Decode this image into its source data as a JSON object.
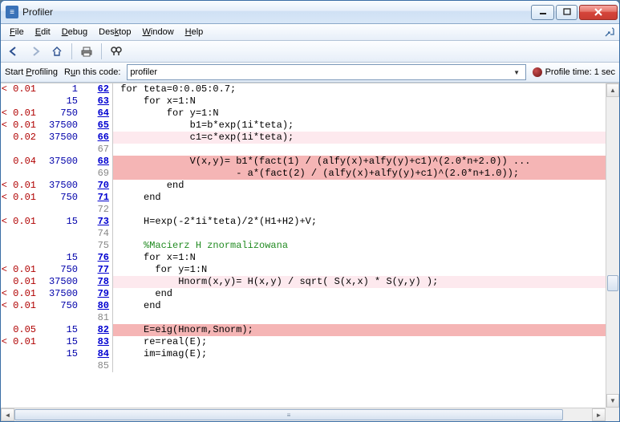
{
  "window": {
    "title": "Profiler",
    "icon_glyph": "≡"
  },
  "menu": [
    "File",
    "Edit",
    "Debug",
    "Desktop",
    "Window",
    "Help"
  ],
  "subbar": {
    "start": "Start Profiling",
    "run": "Run this code:",
    "combo": "profiler",
    "profile_label": "Profile time: 1 sec"
  },
  "code": [
    {
      "time": "< 0.01",
      "calls": "1",
      "line": "62",
      "link": true,
      "hl": "",
      "text": "for teta=0:0.05:0.7;"
    },
    {
      "time": "",
      "calls": "15",
      "line": "63",
      "link": true,
      "hl": "",
      "text": "    for x=1:N"
    },
    {
      "time": "< 0.01",
      "calls": "750",
      "line": "64",
      "link": true,
      "hl": "",
      "text": "        for y=1:N"
    },
    {
      "time": "< 0.01",
      "calls": "37500",
      "line": "65",
      "link": true,
      "hl": "",
      "text": "            b1=b*exp(1i*teta);"
    },
    {
      "time": "0.02",
      "calls": "37500",
      "line": "66",
      "link": true,
      "hl": "pink",
      "text": "            c1=c*exp(1i*teta);"
    },
    {
      "time": "",
      "calls": "",
      "line": "67",
      "link": false,
      "hl": "",
      "text": ""
    },
    {
      "time": "0.04",
      "calls": "37500",
      "line": "68",
      "link": true,
      "hl": "red",
      "text": "            V(x,y)= b1*(fact(1) / (alfy(x)+alfy(y)+c1)^(2.0*n+2.0)) ..."
    },
    {
      "time": "",
      "calls": "",
      "line": "69",
      "link": false,
      "hl": "red",
      "text": "                    - a*(fact(2) / (alfy(x)+alfy(y)+c1)^(2.0*n+1.0));"
    },
    {
      "time": "< 0.01",
      "calls": "37500",
      "line": "70",
      "link": true,
      "hl": "",
      "text": "        end"
    },
    {
      "time": "< 0.01",
      "calls": "750",
      "line": "71",
      "link": true,
      "hl": "",
      "text": "    end"
    },
    {
      "time": "",
      "calls": "",
      "line": "72",
      "link": false,
      "hl": "",
      "text": ""
    },
    {
      "time": "< 0.01",
      "calls": "15",
      "line": "73",
      "link": true,
      "hl": "",
      "text": "    H=exp(-2*1i*teta)/2*(H1+H2)+V;"
    },
    {
      "time": "",
      "calls": "",
      "line": "74",
      "link": false,
      "hl": "",
      "text": ""
    },
    {
      "time": "",
      "calls": "",
      "line": "75",
      "link": false,
      "hl": "",
      "text": "    %Macierz H znormalizowana",
      "comment": true
    },
    {
      "time": "",
      "calls": "15",
      "line": "76",
      "link": true,
      "hl": "",
      "text": "    for x=1:N"
    },
    {
      "time": "< 0.01",
      "calls": "750",
      "line": "77",
      "link": true,
      "hl": "",
      "text": "      for y=1:N"
    },
    {
      "time": "0.01",
      "calls": "37500",
      "line": "78",
      "link": true,
      "hl": "pink",
      "text": "          Hnorm(x,y)= H(x,y) / sqrt( S(x,x) * S(y,y) );"
    },
    {
      "time": "< 0.01",
      "calls": "37500",
      "line": "79",
      "link": true,
      "hl": "",
      "text": "      end"
    },
    {
      "time": "< 0.01",
      "calls": "750",
      "line": "80",
      "link": true,
      "hl": "",
      "text": "    end"
    },
    {
      "time": "",
      "calls": "",
      "line": "81",
      "link": false,
      "hl": "",
      "text": ""
    },
    {
      "time": "0.05",
      "calls": "15",
      "line": "82",
      "link": true,
      "hl": "red",
      "text": "    E=eig(Hnorm,Snorm);"
    },
    {
      "time": "< 0.01",
      "calls": "15",
      "line": "83",
      "link": true,
      "hl": "",
      "text": "    re=real(E);"
    },
    {
      "time": "",
      "calls": "15",
      "line": "84",
      "link": true,
      "hl": "",
      "text": "    im=imag(E);"
    },
    {
      "time": "",
      "calls": "",
      "line": "85",
      "link": false,
      "hl": "",
      "text": ""
    }
  ]
}
